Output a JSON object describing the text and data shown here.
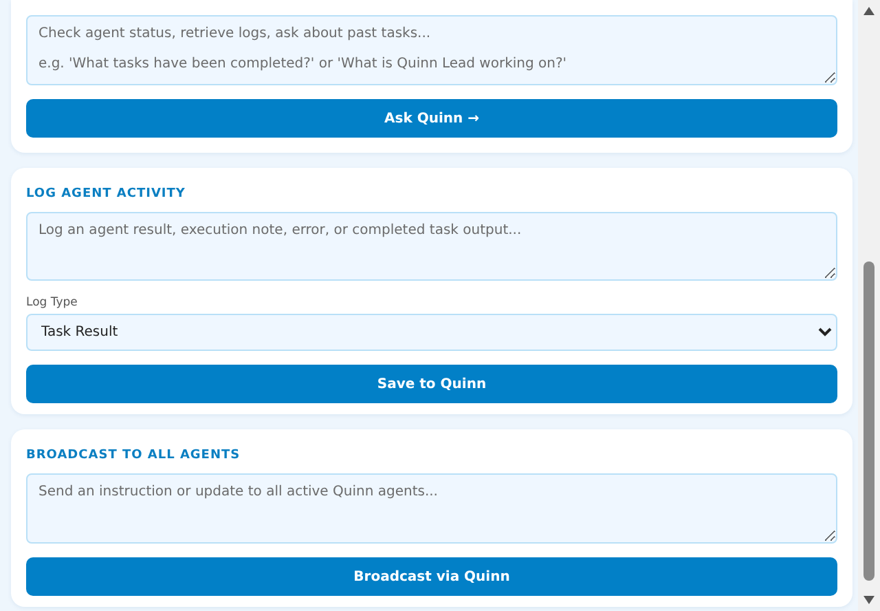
{
  "ask_panel": {
    "query": {
      "placeholder": "Check agent status, retrieve logs, ask about past tasks...\n\ne.g. 'What tasks have been completed?' or 'What is Quinn Lead working on?'"
    },
    "button": "Ask Quinn →"
  },
  "log_panel": {
    "heading": "LOG AGENT ACTIVITY",
    "note": {
      "placeholder": "Log an agent result, execution note, error, or completed task output..."
    },
    "log_type": {
      "label": "Log Type",
      "value": "Task Result"
    },
    "button": "Save to Quinn"
  },
  "broadcast_panel": {
    "heading": "BROADCAST TO ALL AGENTS",
    "message": {
      "placeholder": "Send an instruction or update to all active Quinn agents..."
    },
    "button": "Broadcast via Quinn"
  }
}
